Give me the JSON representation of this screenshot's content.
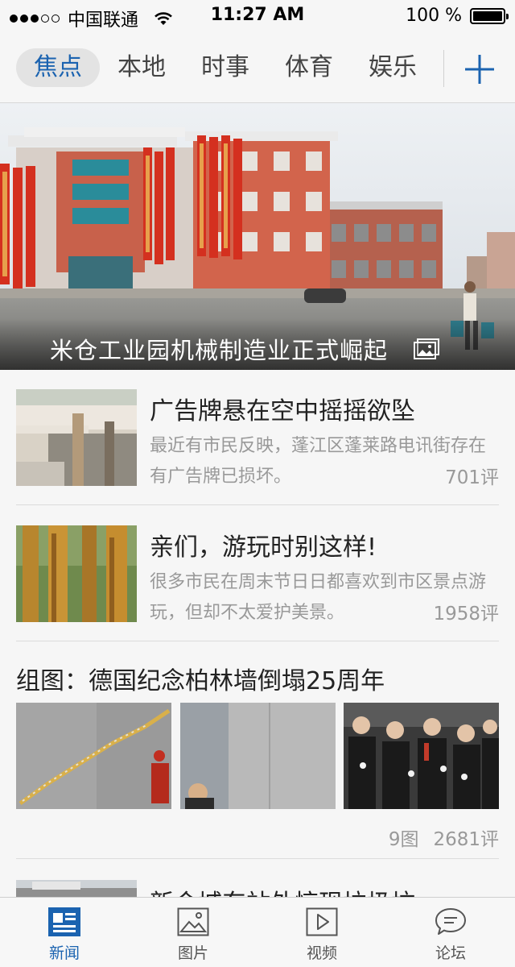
{
  "status_bar": {
    "carrier": "中国联通",
    "time": "11:27 AM",
    "battery": "100 %",
    "signal_strength": 3,
    "signal_max": 5
  },
  "channels": {
    "tabs": [
      {
        "label": "焦点",
        "active": true
      },
      {
        "label": "本地",
        "active": false
      },
      {
        "label": "时事",
        "active": false
      },
      {
        "label": "体育",
        "active": false
      },
      {
        "label": "娱乐",
        "active": false
      }
    ],
    "add_icon": "plus-icon"
  },
  "hero": {
    "title": "米仓工业园机械制造业正式崛起",
    "badge_icon": "photo-gallery-icon"
  },
  "news": [
    {
      "title": "广告牌悬在空中摇摇欲坠",
      "summary": "最近有市民反映，蓬江区蓬莱路电讯街存在有广告牌已损坏。",
      "comments": "701评"
    },
    {
      "title": "亲们，游玩时别这样!",
      "summary": "很多市民在周末节日日都喜欢到市区景点游玩，但却不太爱护美景。",
      "comments": "1958评"
    }
  ],
  "gallery": {
    "title": "组图：德国纪念柏林墙倒塌25周年",
    "count": "9图",
    "comments": "2681评"
  },
  "partial_news": {
    "title": "新会城东站外惊现垃圾坑"
  },
  "tab_bar": {
    "items": [
      {
        "label": "新闻",
        "icon": "news-icon",
        "active": true
      },
      {
        "label": "图片",
        "icon": "image-icon",
        "active": false
      },
      {
        "label": "视频",
        "icon": "video-play-icon",
        "active": false
      },
      {
        "label": "论坛",
        "icon": "chat-bubble-icon",
        "active": false
      }
    ]
  },
  "colors": {
    "accent": "#1b63b0",
    "background": "#f6f6f6",
    "secondary_text": "#999999"
  }
}
